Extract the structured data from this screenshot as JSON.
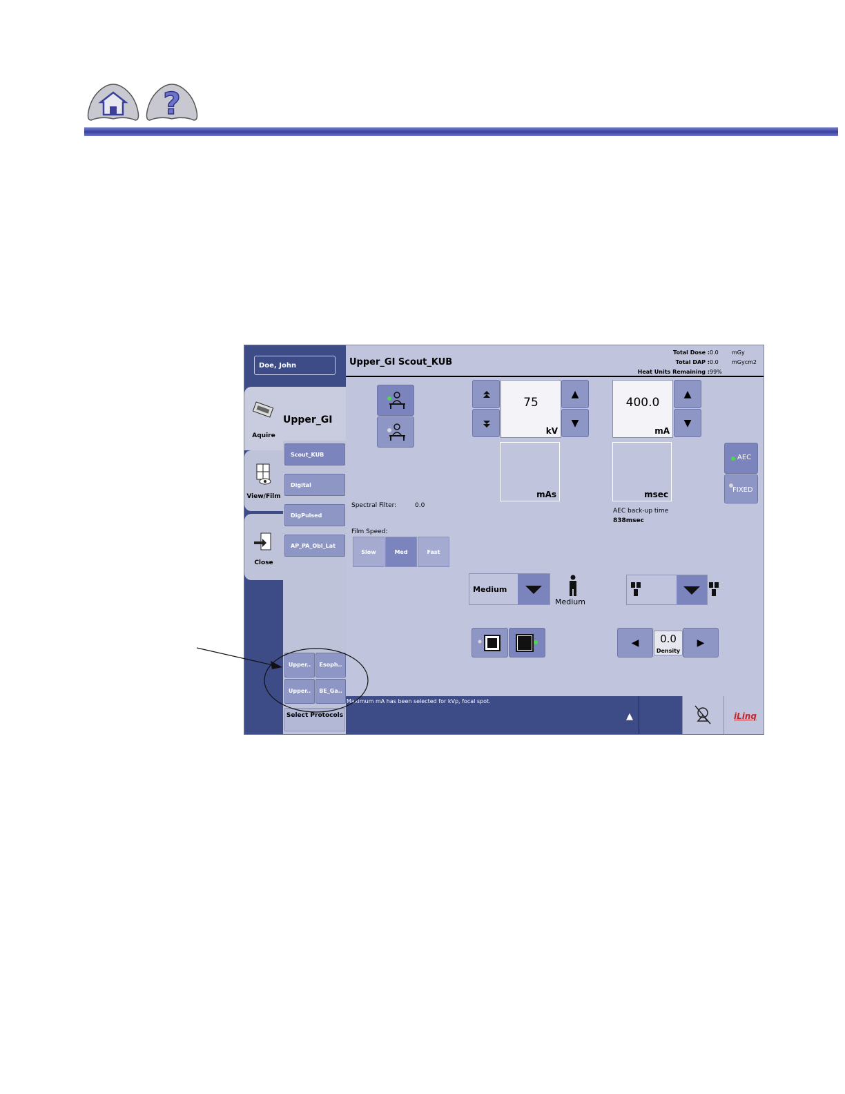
{
  "page": {
    "home_icon": "home-icon",
    "help_icon": "question-icon",
    "accent": "#3a40a0"
  },
  "app": {
    "patient_name": "Doe, John",
    "tabs": [
      {
        "label": "Aquire",
        "icon": "acquire-icon"
      },
      {
        "label": "View/Film",
        "icon": "view-film-icon"
      },
      {
        "label": "Close",
        "icon": "close-door-icon"
      }
    ],
    "protocol_name": "Upper_GI",
    "views": [
      "Scout_KUB",
      "Digital",
      "DigPulsed",
      "AP_PA_Obl_Lat"
    ],
    "protocol_groups": [
      "Upper..",
      "Esoph..",
      "Upper..",
      "BE_Ga.."
    ],
    "select_protocols": "Select Protocols",
    "header": {
      "title": "Upper_GI  Scout_KUB",
      "total_dose_label": "Total Dose :",
      "total_dose_value": "0.0",
      "total_dose_unit": "mGy",
      "total_dap_label": "Total DAP :",
      "total_dap_value": "0.0",
      "total_dap_unit": "mGycm2",
      "heat_label": "Heat Units Remaining :",
      "heat_value": "99%"
    },
    "technique": {
      "kv_value": "75",
      "kv_unit": "kV",
      "ma_value": "400.0",
      "ma_unit": "mA",
      "mas_unit": "mAs",
      "msec_unit": "msec",
      "spectral_filter_label": "Spectral Filter:",
      "spectral_filter_value": "0.0",
      "aec_backup_label": "AEC back-up time",
      "aec_backup_value": "838msec",
      "aec_label": "AEC",
      "fixed_label": "FIXED"
    },
    "film_speed": {
      "label": "Film Speed:",
      "options": [
        "Slow",
        "Med",
        "Fast"
      ],
      "selected": "Med"
    },
    "patient_size": {
      "value": "Medium",
      "caption": "Medium"
    },
    "density": {
      "value": "0.0",
      "label": "Density"
    },
    "status_message": "Maximum mA has been selected for kVp, focal spot.",
    "logo_text": "iLinq"
  }
}
